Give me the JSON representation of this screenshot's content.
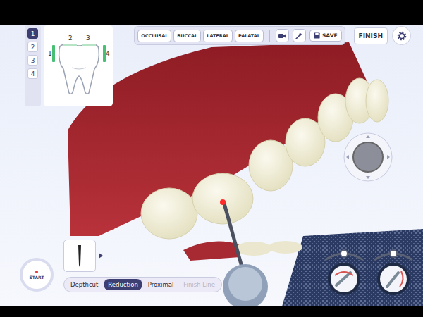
{
  "surface_list": [
    {
      "label": "1",
      "selected": true
    },
    {
      "label": "2",
      "selected": false
    },
    {
      "label": "3",
      "selected": false
    },
    {
      "label": "4",
      "selected": false
    }
  ],
  "tooth_diagram": {
    "surfaces": [
      {
        "label": "1",
        "highlighted": true
      },
      {
        "label": "2",
        "highlighted": false
      },
      {
        "label": "3",
        "highlighted": false
      },
      {
        "label": "4",
        "highlighted": true
      }
    ]
  },
  "view_buttons": [
    "OCCLUSAL",
    "BUCCAL",
    "LATERAL",
    "PALATAL"
  ],
  "save_button": "SAVE",
  "finish_button": "FINISH",
  "start_button": "START",
  "modes": [
    {
      "label": "Depthcut",
      "selected": false,
      "disabled": false
    },
    {
      "label": "Reduction",
      "selected": true,
      "disabled": false
    },
    {
      "label": "Proximal",
      "selected": false,
      "disabled": false
    },
    {
      "label": "Finish Line",
      "selected": false,
      "disabled": true
    }
  ]
}
